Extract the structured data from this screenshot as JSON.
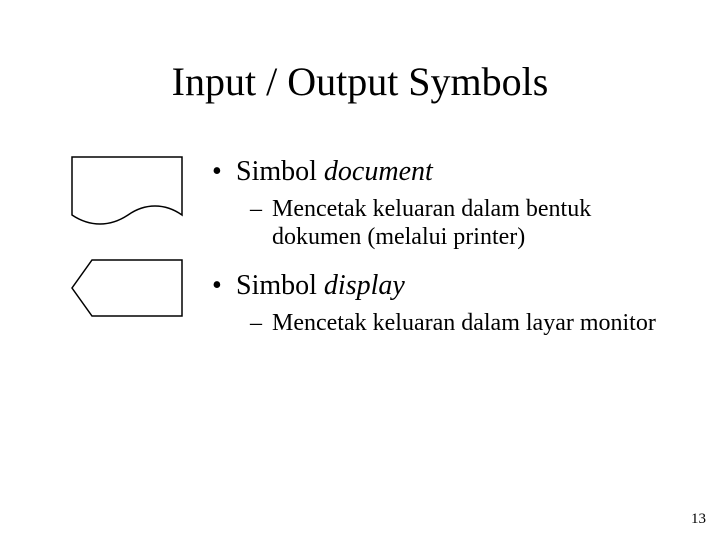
{
  "title": "Input / Output Symbols",
  "items": [
    {
      "label_prefix": "Simbol ",
      "label_em": "document",
      "desc": "Mencetak keluaran dalam bentuk dokumen (melalui printer)",
      "shape": "document-symbol"
    },
    {
      "label_prefix": "Simbol ",
      "label_em": "display",
      "desc": "Mencetak keluaran dalam layar monitor",
      "shape": "display-symbol"
    }
  ],
  "page_number": "13"
}
